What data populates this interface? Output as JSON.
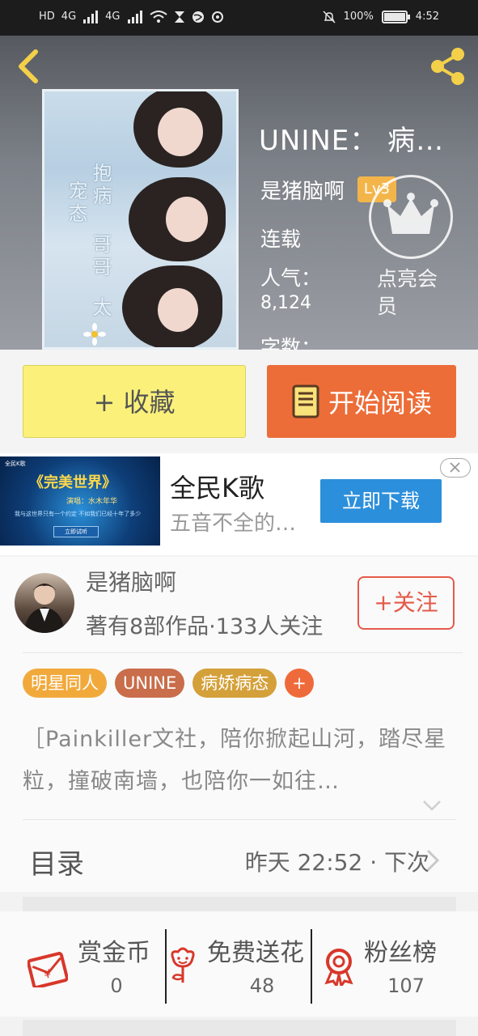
{
  "status_bar": {
    "network": "HD",
    "signal1": "4G",
    "signal2": "4G",
    "battery": "100%",
    "battery_level": 1.0,
    "time": "4:52"
  },
  "book": {
    "title": "UNINE： 病态 …",
    "author": "是猪脑啊",
    "level": "Lv3",
    "status": "连载",
    "popularity_label": "人气：",
    "popularity_value": "8,124",
    "words_label": "字数：",
    "vip_label": "点亮会员",
    "cover_text": [
      "抱病",
      "宠态",
      "哥哥",
      "太"
    ]
  },
  "actions": {
    "collect_label": "+ 收藏",
    "read_label": "开始阅读"
  },
  "ad": {
    "image_title": "《完美世界》",
    "image_logo": "全民K歌",
    "image_subtitle": "演唱：水木年华",
    "image_line": "我与这世界只有一个约定 不如我们已经十年了多少",
    "image_button": "立即试听",
    "title": "全民K歌",
    "description": "五音不全的…",
    "download_label": "立即下载"
  },
  "author_card": {
    "name": "是猪脑啊",
    "stats": "著有8部作品·133人关注",
    "follow_label": "+关注"
  },
  "tags": [
    {
      "label": "明星同人",
      "color": "#f2a93b"
    },
    {
      "label": "UNINE",
      "color": "#c96d4a"
    },
    {
      "label": "病娇病态",
      "color": "#d4a03a"
    },
    {
      "label": "+",
      "color": "#ef6a3a"
    }
  ],
  "intro": "［Painkiller文社，陪你掀起山河，踏尽星粒，撞破南墙，也陪你一如往…",
  "toc": {
    "label": "目录",
    "update": "昨天 22:52 · 下次"
  },
  "bottom_stats": [
    {
      "label": "赏金币",
      "value": "0",
      "icon": "red-envelope-icon"
    },
    {
      "label": "免费送花",
      "value": "48",
      "icon": "flower-icon"
    },
    {
      "label": "粉丝榜",
      "value": "107",
      "icon": "medal-icon"
    }
  ],
  "colors": {
    "accent_orange": "#ec6d38",
    "collect_yellow": "#fbf17a",
    "follow_red": "#e55a4a",
    "icon_red": "#d8372a"
  }
}
